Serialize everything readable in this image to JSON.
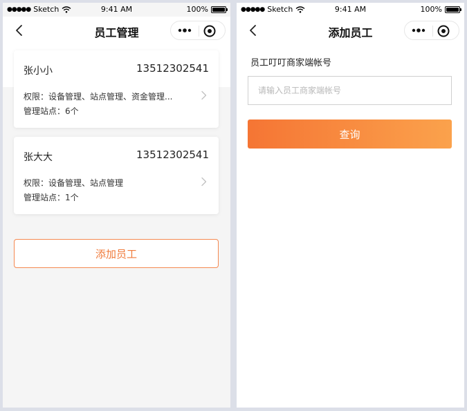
{
  "status_bar": {
    "carrier": "Sketch",
    "time": "9:41 AM",
    "battery": "100%"
  },
  "left_screen": {
    "title": "员工管理",
    "employees": [
      {
        "name": "张小小",
        "phone": "13512302541",
        "permissions": "权限：设备管理、站点管理、资金管理...",
        "sites": "管理站点：6个"
      },
      {
        "name": "张大大",
        "phone": "13512302541",
        "permissions": "权限：设备管理、站点管理",
        "sites": "管理站点：1个"
      }
    ],
    "add_button_label": "添加员工"
  },
  "right_screen": {
    "title": "添加员工",
    "field_label": "员工叮叮商家端帐号",
    "input_placeholder": "请输入员工商家端帐号",
    "input_value": "",
    "query_button_label": "查询"
  },
  "icons": {
    "back": "chevron-left-icon",
    "more": "more-dots-icon",
    "close": "target-circle-icon",
    "row_arrow": "chevron-right-icon",
    "wifi": "wifi-icon",
    "battery": "battery-icon"
  },
  "colors": {
    "accent": "#f07a3a",
    "gradient_start": "#f57534",
    "gradient_end": "#fba24c",
    "page_bg": "#f5f5f5"
  }
}
